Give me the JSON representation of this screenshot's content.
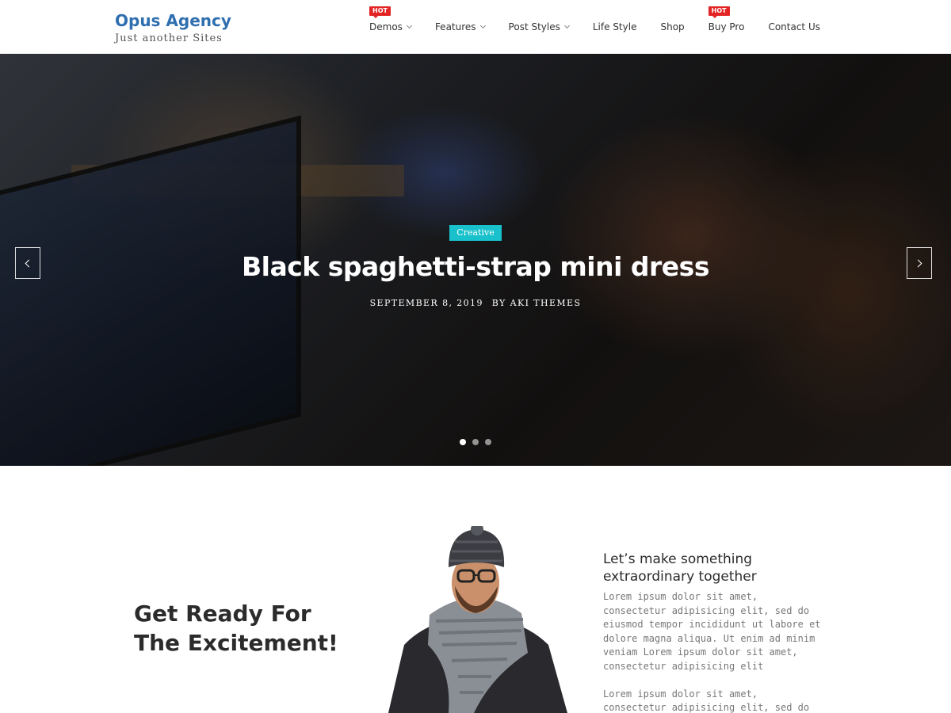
{
  "header": {
    "site_title": "Opus Agency",
    "tagline": "Just another Sites",
    "nav": [
      {
        "label": "Demos",
        "hot": "HOT",
        "dropdown": true
      },
      {
        "label": "Features",
        "hot": "",
        "dropdown": true
      },
      {
        "label": "Post Styles",
        "hot": "",
        "dropdown": true
      },
      {
        "label": "Life Style",
        "hot": "",
        "dropdown": false
      },
      {
        "label": "Shop",
        "hot": "",
        "dropdown": false
      },
      {
        "label": "Buy Pro",
        "hot": "HOT",
        "dropdown": false
      },
      {
        "label": "Contact Us",
        "hot": "",
        "dropdown": false
      }
    ]
  },
  "hero": {
    "category": "Creative",
    "title": "Black spaghetti-strap mini dress",
    "date": "September 8, 2019",
    "author": "By Aki Themes",
    "slides": 3,
    "active_slide": 1
  },
  "about": {
    "heading": "Get Ready For The Excitement!",
    "subheading": "Let’s make something extraordinary together",
    "paragraph1": "Lorem ipsum dolor sit amet, consectetur adipisicing elit, sed do eiusmod tempor incididunt ut labore et dolore magna aliqua. Ut enim ad minim veniam Lorem ipsum dolor sit amet, consectetur adipisicing elit",
    "paragraph2": "Lorem ipsum dolor sit amet, consectetur adipisicing elit, sed do eiusmod"
  },
  "colors": {
    "brand": "#2f6fb0",
    "badge": "#18c1cb",
    "hot": "#e22424"
  }
}
